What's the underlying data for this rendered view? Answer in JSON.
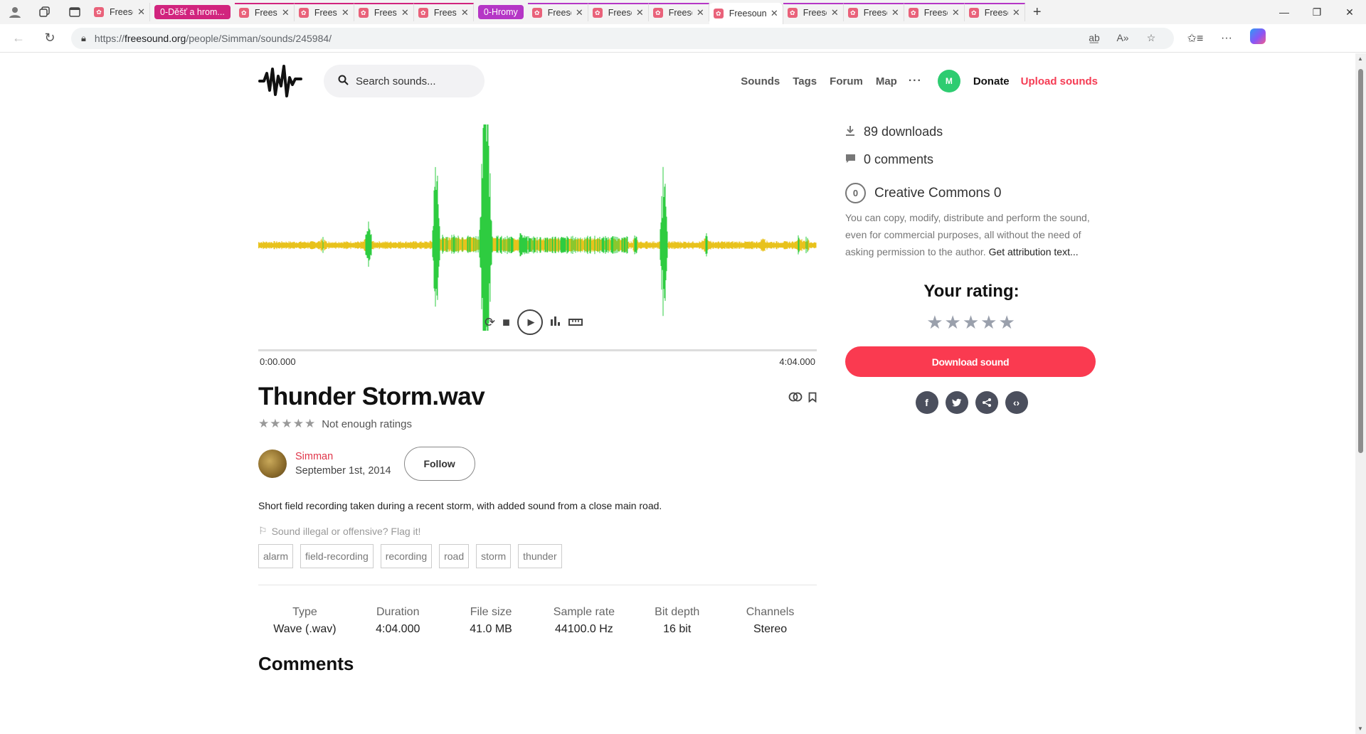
{
  "browser": {
    "tabs": [
      {
        "title": "Freesound",
        "kind": "tab"
      },
      {
        "title": "0-Děšť a hrom...",
        "kind": "group-label"
      },
      {
        "title": "Freesound",
        "kind": "grouped"
      },
      {
        "title": "Freesound",
        "kind": "grouped"
      },
      {
        "title": "Freesound",
        "kind": "grouped"
      },
      {
        "title": "Freesound",
        "kind": "grouped"
      },
      {
        "title": "0-Hromy",
        "kind": "group-label2"
      },
      {
        "title": "Freesound",
        "kind": "grouped2"
      },
      {
        "title": "Freesound",
        "kind": "grouped2"
      },
      {
        "title": "Freesound",
        "kind": "grouped2"
      },
      {
        "title": "Freesound",
        "kind": "active"
      },
      {
        "title": "Freesound",
        "kind": "grouped2"
      },
      {
        "title": "Freesound",
        "kind": "grouped2"
      },
      {
        "title": "Freesound",
        "kind": "grouped2"
      },
      {
        "title": "Freesound",
        "kind": "grouped2"
      }
    ],
    "url_prefix": "https://",
    "url_host": "freesound.org",
    "url_path": "/people/Simman/sounds/245984/"
  },
  "header": {
    "search_placeholder": "Search sounds...",
    "nav": [
      "Sounds",
      "Tags",
      "Forum",
      "Map"
    ],
    "more": "···",
    "avatar_initial": "M",
    "donate": "Donate",
    "upload": "Upload sounds"
  },
  "waveform": {
    "colors": {
      "low": "#e8c21c",
      "high": "#2ecc40"
    }
  },
  "player": {
    "time_start": "0:00.000",
    "time_end": "4:04.000",
    "progress": 0
  },
  "sound": {
    "title": "Thunder Storm.wav",
    "stars": "★★★★★",
    "rating_text": "Not enough ratings",
    "author": "Simman",
    "date": "September 1st, 2014",
    "follow": "Follow",
    "description": "Short field recording taken during a recent storm, with added sound from a close main road.",
    "flag": "Sound illegal or offensive? Flag it!",
    "tags": [
      "alarm",
      "field-recording",
      "recording",
      "road",
      "storm",
      "thunder"
    ],
    "properties": [
      {
        "label": "Type",
        "value": "Wave (.wav)"
      },
      {
        "label": "Duration",
        "value": "4:04.000"
      },
      {
        "label": "File size",
        "value": "41.0 MB"
      },
      {
        "label": "Sample rate",
        "value": "44100.0 Hz"
      },
      {
        "label": "Bit depth",
        "value": "16 bit"
      },
      {
        "label": "Channels",
        "value": "Stereo"
      }
    ],
    "comments_heading": "Comments"
  },
  "sidebar": {
    "downloads": "89 downloads",
    "comments": "0 comments",
    "license_icon": "0",
    "license": "Creative Commons 0",
    "license_text": "You can copy, modify, distribute and perform the sound, even for commercial purposes, all without the need of asking permission to the author.",
    "license_link": "Get attribution text...",
    "your_rating": "Your rating:",
    "rating_stars": "★★★★★",
    "download": "Download sound"
  },
  "colors": {
    "brand_red": "#fa3a50",
    "author_link": "#e0364a",
    "avatar_green": "#2ecc71"
  }
}
